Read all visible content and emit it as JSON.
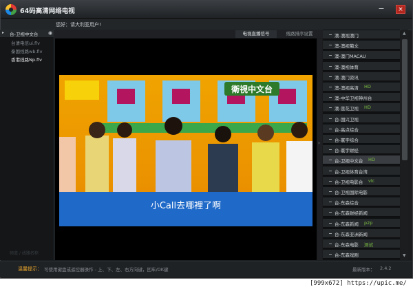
{
  "window": {
    "title": "64码高清网络电视",
    "minimize": "−",
    "close": "×"
  },
  "greeting": "您好：请大利亚用户!",
  "left_panel": {
    "group_label": "台-卫视中文台",
    "group_arrow": "▸",
    "eye_icon": "◉",
    "sources": [
      {
        "label": "台清电信ui.flv",
        "active": false
      },
      {
        "label": "泰国线路wb.flv",
        "active": false
      },
      {
        "label": "香港线路Np.flv",
        "active": true
      }
    ],
    "footer": "频道 / 线路名称"
  },
  "tabs": [
    "电视直播信号",
    "线路排序设置"
  ],
  "video": {
    "channel_logo": "衛視中文台",
    "subtitle": "小Call去哪裡了啊"
  },
  "channels": [
    {
      "name": "澳-澳视澳门",
      "tag": ""
    },
    {
      "name": "澳-澳视葡文",
      "tag": ""
    },
    {
      "name": "澳-澳门MACAU",
      "tag": ""
    },
    {
      "name": "澳-澳视体育",
      "tag": ""
    },
    {
      "name": "澳-澳门资讯",
      "tag": ""
    },
    {
      "name": "澳-澳视高清",
      "tag": "HD"
    },
    {
      "name": "澳-中华卫视神州台",
      "tag": ""
    },
    {
      "name": "澳-莲花卫视",
      "tag": "HD"
    },
    {
      "name": "台-国兴卫视",
      "tag": ""
    },
    {
      "name": "台-高点综合",
      "tag": ""
    },
    {
      "name": "台-寰宇综合",
      "tag": ""
    },
    {
      "name": "台-寰宇财经",
      "tag": ""
    },
    {
      "name": "台-卫视中文台",
      "tag": "HD"
    },
    {
      "name": "台-卫视体育台湾",
      "tag": ""
    },
    {
      "name": "台-卫视电影台",
      "tag": "vlc"
    },
    {
      "name": "台-卫视国际电影",
      "tag": ""
    },
    {
      "name": "台-东森综合",
      "tag": ""
    },
    {
      "name": "台-东森财经新闻",
      "tag": ""
    },
    {
      "name": "台-东森新闻",
      "tag": "p2p"
    },
    {
      "name": "台-东森亚洲新闻",
      "tag": ""
    },
    {
      "name": "台-东森电影",
      "tag": "测试"
    },
    {
      "name": "台-东森戏剧",
      "tag": ""
    }
  ],
  "active_channel_index": 12,
  "scrollbar": {
    "up": "▲",
    "down": "▼"
  },
  "status": {
    "tip_label": "温馨提示：",
    "tip_text": "可使用键盘或遥控器操作 - 上、下、左、右方向键，回车/OK键",
    "version_label": "最新版本：",
    "version_value": "2.4.2"
  },
  "watermark": "[999x672] https://upic.me/",
  "colors": {
    "tag_green": "#7cc242",
    "tip_orange": "#e3a22b",
    "close_red": "#b3261e"
  }
}
